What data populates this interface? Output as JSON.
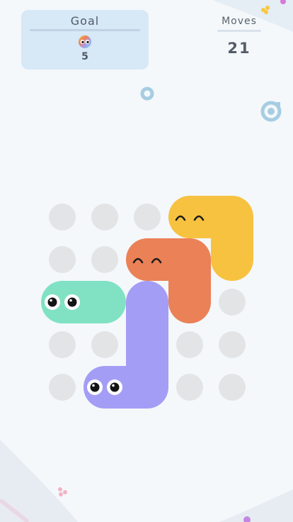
{
  "goal": {
    "title": "Goal",
    "count": "5",
    "icon": "rainbow-blob-face-icon"
  },
  "moves": {
    "label": "Moves",
    "value": "21"
  },
  "restart": {
    "icon": "restart-icon"
  },
  "board": {
    "empty_cells": [
      {
        "col": 0,
        "row": 0
      },
      {
        "col": 1,
        "row": 0
      },
      {
        "col": 2,
        "row": 0
      },
      {
        "col": 0,
        "row": 1
      },
      {
        "col": 1,
        "row": 1
      },
      {
        "col": 4,
        "row": 2
      },
      {
        "col": 0,
        "row": 3
      },
      {
        "col": 1,
        "row": 3
      },
      {
        "col": 3,
        "row": 3
      },
      {
        "col": 4,
        "row": 3
      },
      {
        "col": 0,
        "row": 4
      },
      {
        "col": 3,
        "row": 4
      },
      {
        "col": 4,
        "row": 4
      }
    ],
    "blobs": [
      {
        "name": "yellow",
        "color": "#f7c240",
        "cells": [
          [
            3,
            0
          ],
          [
            4,
            0
          ],
          [
            4,
            1
          ]
        ],
        "head": [
          3,
          0
        ],
        "face": "happy"
      },
      {
        "name": "orange",
        "color": "#eb8157",
        "cells": [
          [
            2,
            1
          ],
          [
            3,
            1
          ],
          [
            3,
            2
          ]
        ],
        "head": [
          2,
          1
        ],
        "face": "happy"
      },
      {
        "name": "purple",
        "color": "#a49df5",
        "cells": [
          [
            2,
            2
          ],
          [
            2,
            3
          ],
          [
            2,
            4
          ],
          [
            1,
            4
          ]
        ],
        "head": [
          1,
          4
        ],
        "face": "eyes"
      },
      {
        "name": "green",
        "color": "#80e2c3",
        "cells": [
          [
            0,
            2
          ],
          [
            1,
            2
          ]
        ],
        "head": [
          0,
          2
        ],
        "face": "eyes"
      }
    ]
  },
  "colors": {
    "empty_cell": "#e3e4e6",
    "outline": "#a6cde2"
  }
}
